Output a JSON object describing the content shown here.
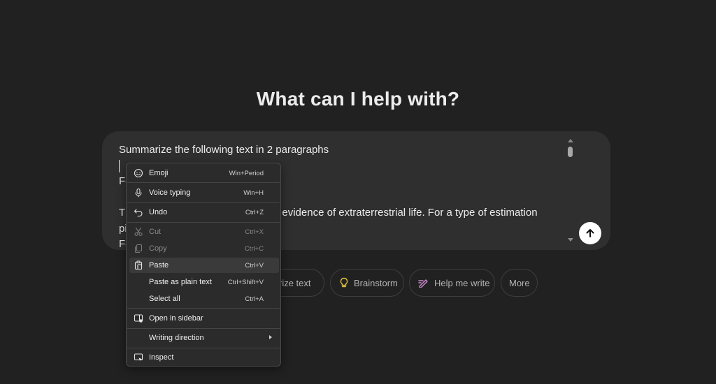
{
  "heading": "What can I help with?",
  "composer": {
    "lines": [
      "Summarize the following text in 2 paragraphs",
      "",
      "Fe",
      "",
      "Th                                           clear evidence of extraterrestrial life. For a type of estimation",
      "pi",
      "Fe"
    ]
  },
  "chips": [
    {
      "label": "rize text",
      "icon": "document-icon"
    },
    {
      "label": "Brainstorm",
      "icon": "lightbulb-icon",
      "color": "#e2c541"
    },
    {
      "label": "Help me write",
      "icon": "pen-icon",
      "color": "#cb8bd0"
    },
    {
      "label": "More"
    }
  ],
  "context_menu": {
    "items": [
      {
        "label": "Emoji",
        "shortcut": "Win+Period",
        "icon": "emoji-icon"
      },
      {
        "label": "Voice typing",
        "shortcut": "Win+H",
        "icon": "microphone-icon"
      },
      {
        "label": "Undo",
        "shortcut": "Ctrl+Z",
        "icon": "undo-icon"
      },
      {
        "label": "Cut",
        "shortcut": "Ctrl+X",
        "icon": "scissors-icon",
        "disabled": true
      },
      {
        "label": "Copy",
        "shortcut": "Ctrl+C",
        "icon": "copy-icon",
        "disabled": true
      },
      {
        "label": "Paste",
        "shortcut": "Ctrl+V",
        "icon": "paste-icon",
        "hover": true
      },
      {
        "label": "Paste as plain text",
        "shortcut": "Ctrl+Shift+V"
      },
      {
        "label": "Select all",
        "shortcut": "Ctrl+A"
      },
      {
        "label": "Open in sidebar",
        "icon": "sidebar-icon"
      },
      {
        "label": "Writing direction",
        "submenu": true
      },
      {
        "label": "Inspect",
        "icon": "inspect-icon"
      }
    ]
  },
  "colors": {
    "background": "#212121",
    "composer": "#2f2f2f",
    "menu": "#2b2b2b"
  }
}
